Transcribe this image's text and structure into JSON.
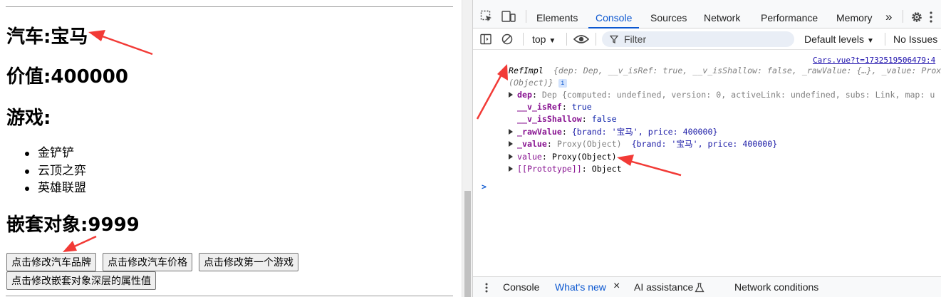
{
  "page": {
    "car_brand": "汽车:宝马",
    "car_price": "价值:400000",
    "games_heading": "游戏:",
    "games": [
      "金铲铲",
      "云顶之弈",
      "英雄联盟"
    ],
    "nested_heading": "嵌套对象:9999",
    "buttons": {
      "change_brand": "点击修改汽车品牌",
      "change_price": "点击修改汽车价格",
      "change_game": "点击修改第一个游戏",
      "change_deep": "点击修改嵌套对象深层的属性值"
    }
  },
  "devtools": {
    "tabs": [
      "Elements",
      "Console",
      "Sources",
      "Network",
      "Performance",
      "Memory"
    ],
    "active_tab": "Console",
    "more_tabs": "»",
    "context": "top",
    "filter_placeholder": "Filter",
    "levels": "Default levels",
    "issues": "No Issues",
    "source_link": "Cars.vue?t=1732519506479:4",
    "log": {
      "header_class": "RefImpl",
      "header_preview": "{dep: Dep, __v_isRef: true, __v_isShallow: false, _rawValue: {…}, _value: Proxy",
      "header_preview_cont": "(Object)}",
      "info_badge": "i",
      "dep_key": "dep",
      "dep_value": "Dep  {computed: undefined, version: 0, activeLink: undefined, subs: Link, map: u",
      "isref_key": "__v_isRef",
      "isref_value": "true",
      "isshallow_key": "__v_isShallow",
      "isshallow_value": "false",
      "rawvalue_key": "_rawValue",
      "rawvalue_value": "{brand: '宝马', price: 400000}",
      "value_key": "_value",
      "value_proxy": "Proxy(Object)",
      "value_value": "{brand: '宝马', price: 400000}",
      "getter_key": "value",
      "getter_value": "Proxy(Object)",
      "proto_key": "[[Prototype]]",
      "proto_value": "Object",
      "prompt": ">"
    },
    "drawer": {
      "tabs": [
        "Console",
        "What's new",
        "AI assistance",
        "Network conditions"
      ],
      "active": "What's new",
      "close": "×"
    }
  },
  "colors": {
    "accent": "#0b57d0",
    "annotation": "#f23a36",
    "string": "#c80000",
    "property": "#881391",
    "number": "#1a1aa6"
  }
}
